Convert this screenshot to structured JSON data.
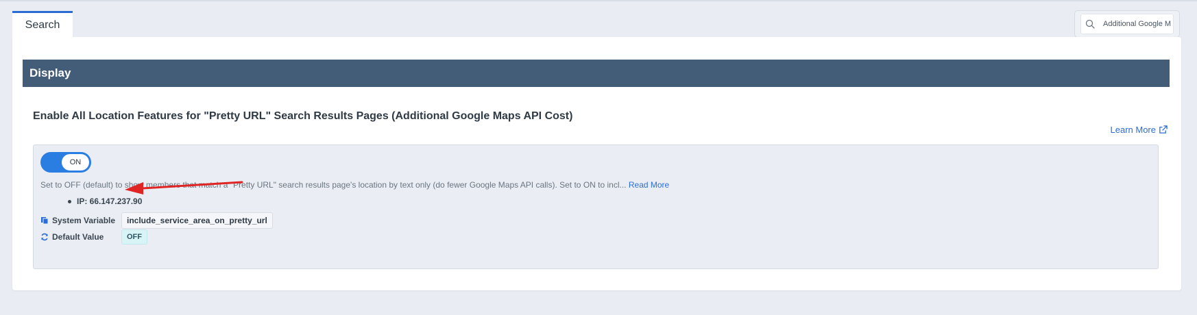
{
  "tabs": [
    {
      "label": "Search",
      "active": true
    }
  ],
  "search": {
    "value": "Additional Google M",
    "icon": "search-icon"
  },
  "section": {
    "title": "Display"
  },
  "setting": {
    "title": "Enable All Location Features for \"Pretty URL\" Search Results Pages (Additional Google Maps API Cost)",
    "learn_more": "Learn More",
    "toggle_state": "ON",
    "description": "Set to OFF (default) to show members that match a \"Pretty URL\" search results page's location by text only (do fewer Google Maps API calls). Set to ON to incl...",
    "read_more": "Read More",
    "ip": "IP: 66.147.237.90",
    "system_variable_label": "System Variable",
    "system_variable_value": "include_service_area_on_pretty_url",
    "default_value_label": "Default Value",
    "default_value": "OFF"
  },
  "colors": {
    "header_bg": "#435d78",
    "accent": "#2b6cd4",
    "toggle": "#2a7de1",
    "annotation_arrow": "#e02424"
  }
}
